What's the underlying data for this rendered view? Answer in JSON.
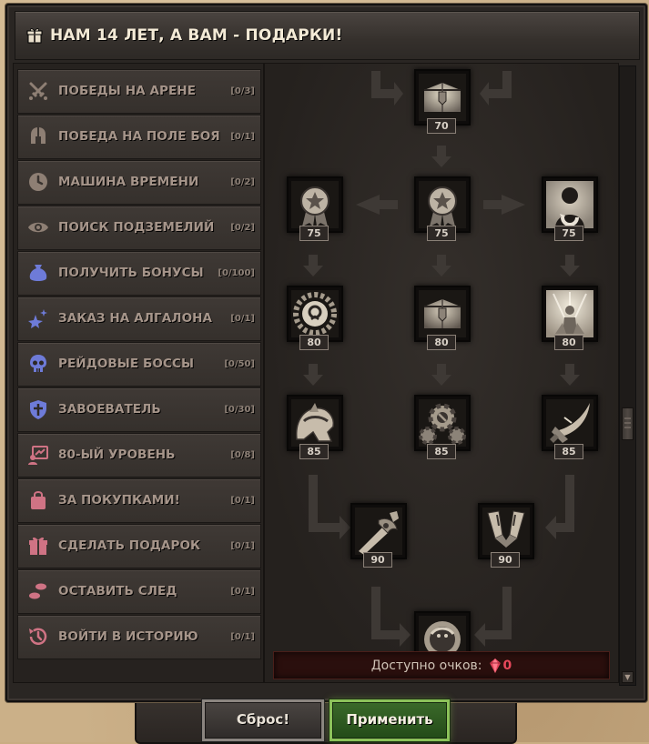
{
  "window": {
    "title": "НАМ 14 ЛЕТ, А ВАМ - ПОДАРКИ!",
    "title_icon": "gift-icon"
  },
  "categories": [
    {
      "label": "ПОБЕДЫ НА АРЕНЕ",
      "count": "[0/3]",
      "icon": "crossed-swords-icon",
      "icon_color": "#8e7f74"
    },
    {
      "label": "ПОБЕДА НА ПОЛЕ БОЯ",
      "count": "[0/1]",
      "icon": "helmet-icon",
      "icon_color": "#8e7f74"
    },
    {
      "label": "МАШИНА ВРЕМЕНИ",
      "count": "[0/2]",
      "icon": "clock-icon",
      "icon_color": "#8e7f74"
    },
    {
      "label": "ПОИСК ПОДЗЕМЕЛИЙ",
      "count": "[0/2]",
      "icon": "eye-icon",
      "icon_color": "#8e7f74"
    },
    {
      "label": "ПОЛУЧИТЬ БОНУСЫ",
      "count": "[0/100]",
      "icon": "money-bag-icon",
      "icon_color": "#6e7bd8"
    },
    {
      "label": "ЗАКАЗ НА АЛГАЛОНА",
      "count": "[0/1]",
      "icon": "stars-icon",
      "icon_color": "#6e7bd8"
    },
    {
      "label": "РЕЙДОВЫЕ БОССЫ",
      "count": "[0/50]",
      "icon": "skull-icon",
      "icon_color": "#6e7bd8"
    },
    {
      "label": "ЗАВОЕВАТЕЛЬ",
      "count": "[0/30]",
      "icon": "shield-icon",
      "icon_color": "#6e7bd8"
    },
    {
      "label": "80-ЫЙ УРОВЕНЬ",
      "count": "[0/8]",
      "icon": "level-up-icon",
      "icon_color": "#cf7384"
    },
    {
      "label": "ЗА ПОКУПКАМИ!",
      "count": "[0/1]",
      "icon": "shopping-bag-icon",
      "icon_color": "#cf7384"
    },
    {
      "label": "СДЕЛАТЬ ПОДАРОК",
      "count": "[0/1]",
      "icon": "gift-icon",
      "icon_color": "#cf7384"
    },
    {
      "label": "ОСТАВИТЬ СЛЕД",
      "count": "[0/1]",
      "icon": "footprints-icon",
      "icon_color": "#cf7384"
    },
    {
      "label": "ВОЙТИ В ИСТОРИЮ",
      "count": "[0/1]",
      "icon": "history-icon",
      "icon_color": "#cf7384"
    }
  ],
  "tree": {
    "nodes": [
      {
        "id": "chest-top",
        "cost": "70",
        "icon": "treasure-chest-icon"
      },
      {
        "id": "medal-left",
        "cost": "75",
        "icon": "star-medal-icon"
      },
      {
        "id": "medal-center",
        "cost": "75",
        "icon": "star-medal-icon"
      },
      {
        "id": "silhouette-right",
        "cost": "75",
        "icon": "character-silhouette-icon"
      },
      {
        "id": "sun-ring",
        "cost": "80",
        "icon": "sun-ring-icon"
      },
      {
        "id": "chest-mid",
        "cost": "80",
        "icon": "treasure-chest-icon"
      },
      {
        "id": "figure-light",
        "cost": "80",
        "icon": "radiant-figure-icon"
      },
      {
        "id": "helm-left",
        "cost": "85",
        "icon": "plate-helm-icon"
      },
      {
        "id": "gears-center",
        "cost": "85",
        "icon": "gears-icon"
      },
      {
        "id": "blade-right",
        "cost": "85",
        "icon": "curved-blade-icon"
      },
      {
        "id": "sword-left",
        "cost": "90",
        "icon": "ornate-sword-icon"
      },
      {
        "id": "gauntlets-right",
        "cost": "90",
        "icon": "gauntlets-icon"
      },
      {
        "id": "mount-bottom",
        "cost": "",
        "icon": "mount-icon"
      }
    ]
  },
  "points": {
    "label": "Доступно очков:",
    "value": "0",
    "icon": "ruby-gem-icon",
    "value_color": "#e8485b"
  },
  "buttons": {
    "reset": "Сброс!",
    "apply": "Применить"
  }
}
